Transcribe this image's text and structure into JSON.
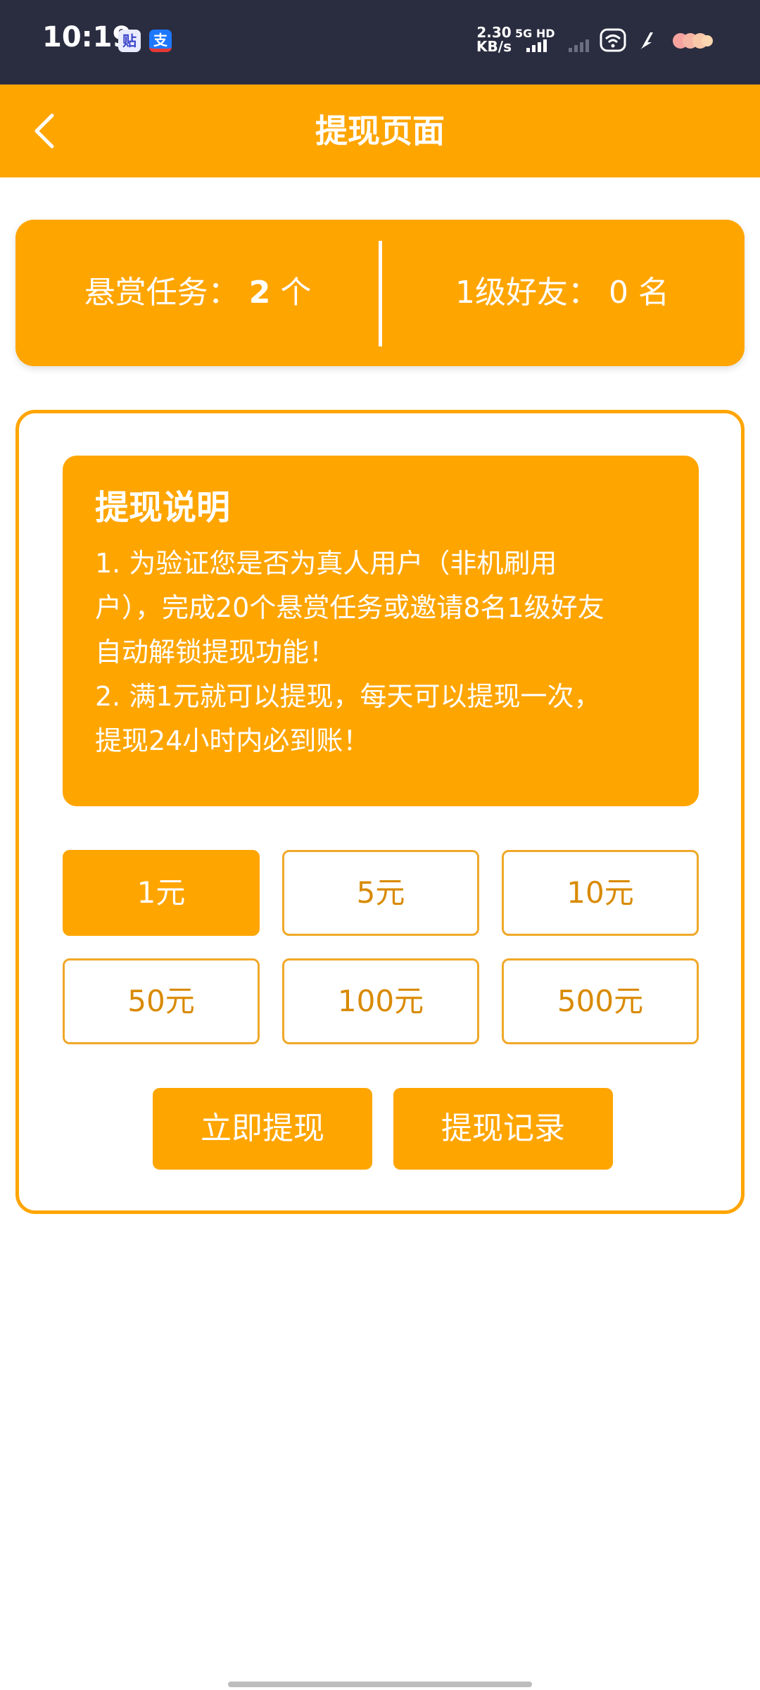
{
  "status_bar": {
    "time": "10:19",
    "app_icons": [
      {
        "name": "tieba-app-icon",
        "glyph": "贴"
      },
      {
        "name": "alipay-app-icon",
        "glyph": "支"
      }
    ],
    "net_speed_value": "2.30",
    "net_speed_unit": "KB/s",
    "network_label": "5G HD"
  },
  "header": {
    "title": "提现页面",
    "back_icon": "chevron-left-icon"
  },
  "stats": {
    "tasks_label": "悬赏任务：",
    "tasks_value": "2",
    "tasks_unit": "个",
    "friends_label": "1级好友：",
    "friends_value": "0",
    "friends_unit": "名"
  },
  "notice": {
    "title": "提现说明",
    "lines": [
      "1. 为验证您是否为真人用户（非机刷用",
      "户），完成20个悬赏任务或邀请8名1级好友",
      "自动解锁提现功能！",
      "2. 满1元就可以提现，每天可以提现一次，",
      "提现24小时内必到账！"
    ]
  },
  "amounts": {
    "options": [
      "1元",
      "5元",
      "10元",
      "50元",
      "100元",
      "500元"
    ],
    "selected": "1元"
  },
  "actions": {
    "withdraw_label": "立即提现",
    "records_label": "提现记录"
  },
  "colors": {
    "accent": "#ffa500",
    "status_bar_bg": "#2a2d40",
    "amount_text": "#d98a00"
  }
}
